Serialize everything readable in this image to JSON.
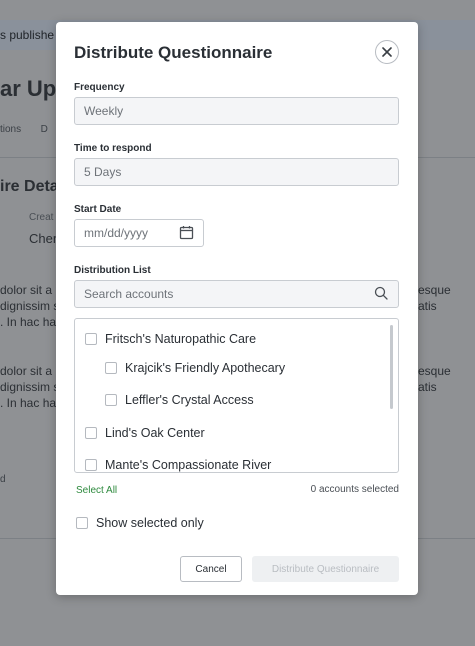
{
  "background": {
    "banner_text": "s publishe",
    "page_title": "ar Upd",
    "tabs_text": "tions       D",
    "section_title": "ire Deta",
    "meta_label": "Creat",
    "meta_value": "Cher",
    "para1": [
      "dolor sit a",
      "dignissim s",
      ". In hac ha"
    ],
    "para1_right": [
      "esque",
      "atis"
    ],
    "para2": [
      "dolor sit a",
      "dignissim s",
      ". In hac ha"
    ],
    "para2_right": [
      "esque",
      "atis"
    ],
    "footer_text": "d"
  },
  "modal": {
    "title": "Distribute Questionnaire",
    "frequency": {
      "label": "Frequency",
      "value": "Weekly"
    },
    "time_to_respond": {
      "label": "Time to respond",
      "value": "5 Days"
    },
    "start_date": {
      "label": "Start Date",
      "placeholder": "mm/dd/yyyy"
    },
    "distribution_list": {
      "label": "Distribution List",
      "search_placeholder": "Search accounts",
      "items": [
        {
          "label": "Fritsch's Naturopathic Care",
          "indent": false,
          "checked": false
        },
        {
          "label": "Krajcik's Friendly Apothecary",
          "indent": true,
          "checked": false
        },
        {
          "label": "Leffler's Crystal Access",
          "indent": true,
          "checked": false
        },
        {
          "label": "Lind's Oak Center",
          "indent": false,
          "checked": false
        },
        {
          "label": "Mante's Compassionate River",
          "indent": false,
          "checked": false
        }
      ]
    },
    "select_all": "Select All",
    "selected_count": "0 accounts selected",
    "show_selected_only": "Show selected only",
    "cancel": "Cancel",
    "submit": "Distribute Questionnaire"
  },
  "icons": {
    "close": "close-icon",
    "calendar": "calendar-icon",
    "search": "search-icon"
  },
  "colors": {
    "accent_green": "#2e8a3e",
    "overlay": "#8f9194",
    "disabled_button": "#eef0f2"
  }
}
